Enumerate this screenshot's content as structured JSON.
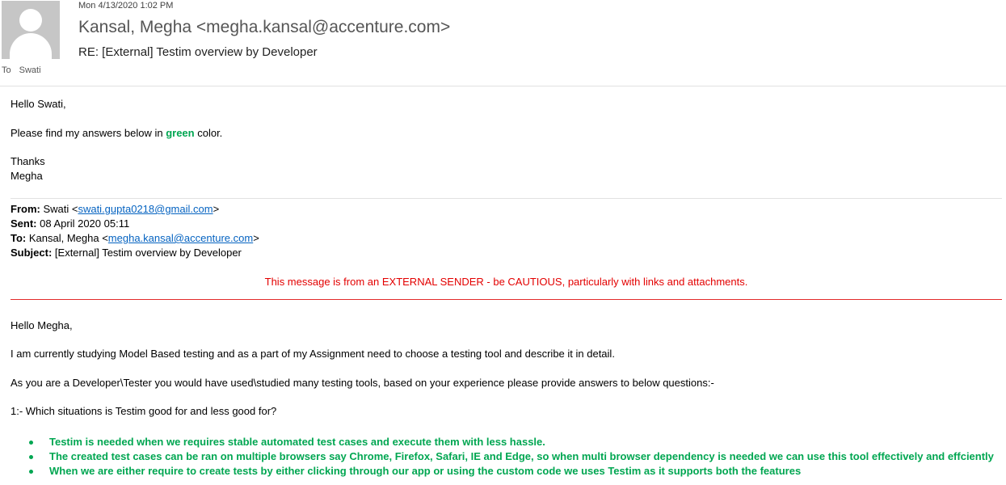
{
  "header": {
    "date": "Mon 4/13/2020 1:02 PM",
    "sender": "Kansal, Megha <megha.kansal@accenture.com>",
    "subject": "RE: [External] Testim overview by Developer",
    "to_label": "To",
    "to_value": "Swati"
  },
  "reply": {
    "greeting": "Hello Swati,",
    "line_prefix": "Please find my answers below in ",
    "line_green": "green",
    "line_suffix": " color.",
    "thanks": "Thanks",
    "signature": "Megha"
  },
  "quoted": {
    "from_label": "From:",
    "from_name": " Swati <",
    "from_email": "swati.gupta0218@gmail.com",
    "from_close": ">",
    "sent_label": "Sent:",
    "sent_value": " 08 April 2020 05:11",
    "to_label": "To:",
    "to_name": " Kansal, Megha <",
    "to_email": "megha.kansal@accenture.com",
    "to_close": ">",
    "subject_label": "Subject:",
    "subject_value": " [External] Testim overview by Developer",
    "warning": "This message is from an EXTERNAL SENDER - be CAUTIOUS, particularly with links and attachments."
  },
  "original": {
    "greeting": "Hello Megha,",
    "para1": "I am currently studying Model Based testing and as a part of my Assignment need to choose a testing tool and describe it in detail.",
    "para2": "As you are a Developer\\Tester you would have used\\studied many testing tools, based on your experience please provide answers to below questions:-",
    "question1": "1:- Which situations is Testim good for and less good for?",
    "answers": [
      "Testim is needed when we requires stable automated test cases and execute them with less hassle.",
      "The created test cases can be ran on multiple browsers say Chrome, Firefox, Safari, IE and Edge, so when multi browser dependency is needed we can use this tool effectively and effciently",
      "When we are either require to create tests by either clicking through our app or using the custom code we uses Testim as it supports both the features"
    ]
  },
  "colors": {
    "answer_green": "#00a651",
    "warning_red": "#e30000",
    "link_blue": "#0563c1"
  }
}
